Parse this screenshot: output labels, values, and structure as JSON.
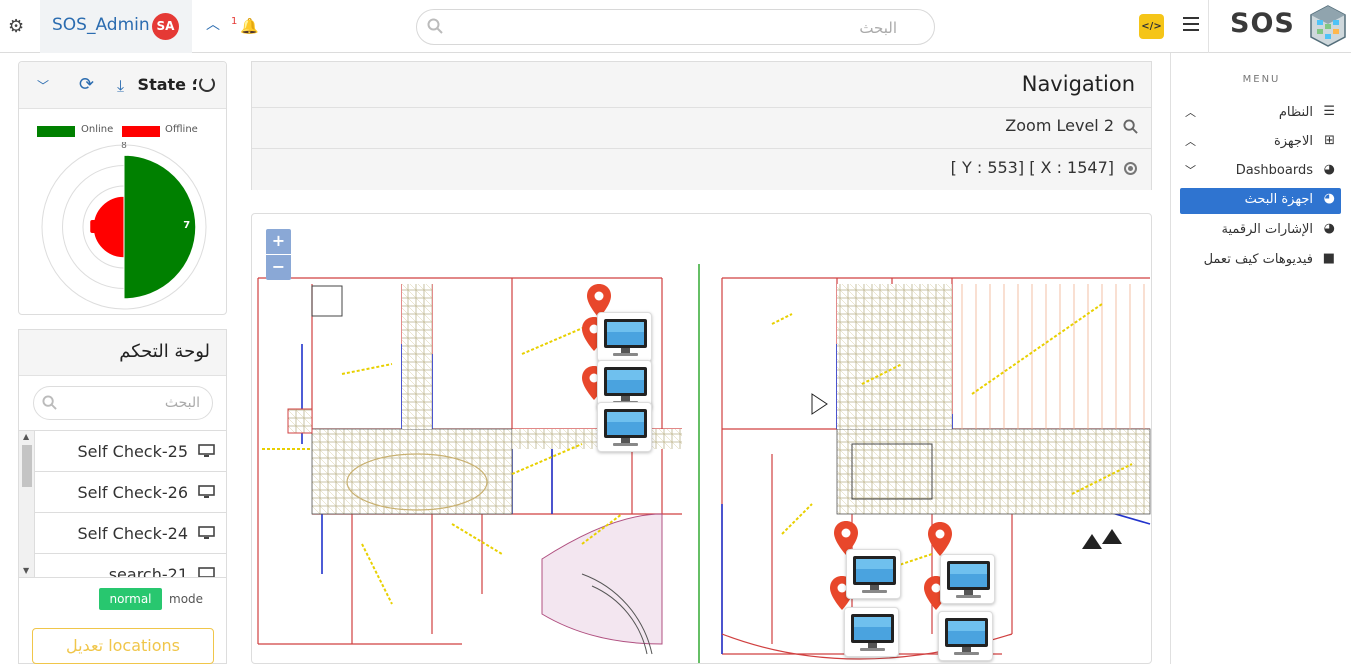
{
  "topbar": {
    "user_name": "SOS_Admin",
    "user_initials": "SA",
    "notification_count": "1",
    "search_placeholder": "البحث",
    "code_button": "</>",
    "brand": "SOS"
  },
  "sidebar": {
    "menu_label": "MENU",
    "items": [
      {
        "label": "النظام",
        "icon": "sliders-icon",
        "chevron": "up",
        "active": false
      },
      {
        "label": "الاجهزة",
        "icon": "network-icon",
        "chevron": "up",
        "active": false
      },
      {
        "label": "Dashboards",
        "icon": "gauge-icon",
        "chevron": "down",
        "active": false
      },
      {
        "label": "اجهزة البحث",
        "icon": "gauge-icon",
        "active": true
      },
      {
        "label": "الإشارات الرقمية",
        "icon": "gauge-icon",
        "active": false
      },
      {
        "label": "فيديوهات كيف تعمل",
        "icon": "video-icon",
        "active": false
      }
    ]
  },
  "state_card": {
    "title": "State ؛",
    "legend": [
      {
        "label": "Online",
        "color": "#008000"
      },
      {
        "label": "Offline",
        "color": "#ff0000"
      }
    ]
  },
  "chart_data": {
    "type": "polar-area",
    "categories": [
      "Online",
      "Offline"
    ],
    "values": [
      7,
      3
    ],
    "colors": [
      "#008000",
      "#ff0000"
    ],
    "rmax": 8,
    "tick_label": "8",
    "data_labels": [
      "7",
      "3"
    ]
  },
  "control_panel": {
    "title": "لوحة التحكم",
    "search_placeholder": "البحث",
    "devices": [
      "Self Check-25",
      "Self Check-26",
      "Self Check-24",
      "search-21"
    ],
    "mode_label": "mode",
    "mode_value": "normal",
    "edit_button": "تعديل locations"
  },
  "navigation": {
    "title": "Navigation",
    "zoom": "Zoom Level 2",
    "coords": "[ Y : 553] [ X : 1547]"
  },
  "map": {
    "zoom_in": "+",
    "zoom_out": "−",
    "marker_color": "#e8472b",
    "markers": 7,
    "monitors": 7
  }
}
